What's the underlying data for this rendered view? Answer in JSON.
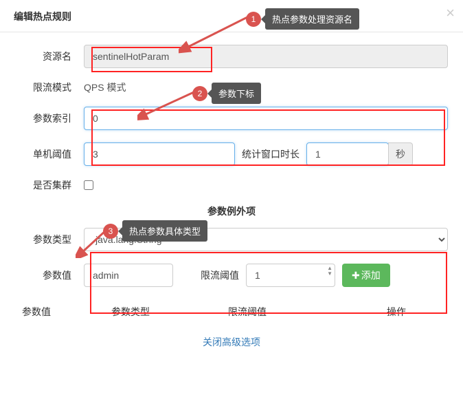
{
  "header": {
    "title": "编辑热点规则"
  },
  "closeGlyph": "×",
  "callouts": {
    "c1": {
      "num": "1",
      "text": "热点参数处理资源名"
    },
    "c2": {
      "num": "2",
      "text": "参数下标"
    },
    "c3": {
      "num": "3",
      "text": "热点参数具体类型"
    }
  },
  "form": {
    "resource": {
      "label": "资源名",
      "value": "sentinelHotParam"
    },
    "mode": {
      "label": "限流模式",
      "value": "QPS 模式"
    },
    "paramIndex": {
      "label": "参数索引",
      "value": "0"
    },
    "threshold": {
      "label": "单机阈值",
      "value": "3"
    },
    "window": {
      "label": "统计窗口时长",
      "value": "1",
      "unit": "秒"
    },
    "cluster": {
      "label": "是否集群"
    },
    "sectionTitle": "参数例外项",
    "paramType": {
      "label": "参数类型",
      "value": "java.lang.String"
    },
    "paramValue": {
      "label": "参数值",
      "value": "admin"
    },
    "limitThreshold": {
      "label": "限流阈值",
      "value": "1"
    },
    "addBtn": "添加"
  },
  "tableHeaders": {
    "h1": "参数值",
    "h2": "参数类型",
    "h3": "限流阈值",
    "h4": "操作"
  },
  "collapseLink": "关闭高级选项",
  "icons": {
    "plus": "✚"
  }
}
